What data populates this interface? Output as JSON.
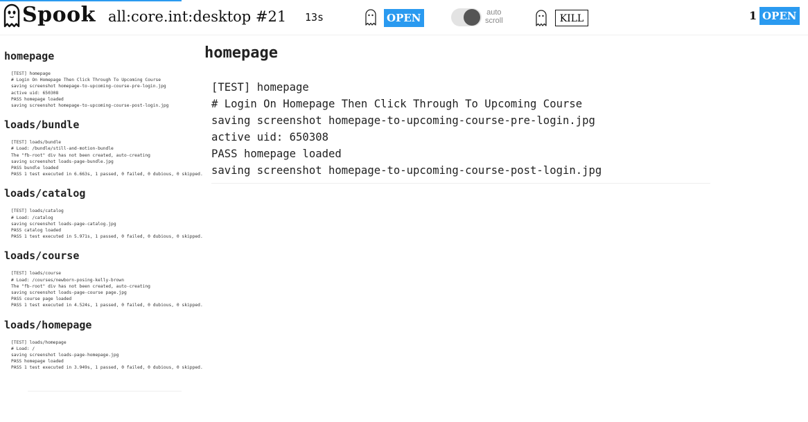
{
  "app": {
    "name": "Spook"
  },
  "header": {
    "job_name": "all:core.int:desktop #21",
    "elapsed": "13s",
    "open_label": "OPEN",
    "autoscroll_line1": "auto",
    "autoscroll_line2": "scroll",
    "autoscroll_enabled": true,
    "kill_label": "KILL",
    "count": "1",
    "open_label_right": "OPEN",
    "accent_color": "#2a9af0"
  },
  "icons": {
    "logo": "ghost-icon",
    "runner": "ghost-icon"
  },
  "tests": [
    {
      "name": "homepage",
      "log": "[TEST] homepage\n# Login On Homepage Then Click Through To Upcoming Course\nsaving screenshot homepage-to-upcoming-course-pre-login.jpg\nactive uid: 650308\nPASS homepage loaded\nsaving screenshot homepage-to-upcoming-course-post-login.jpg"
    },
    {
      "name": "loads/bundle",
      "log": "[TEST] loads/bundle\n# Load: /bundle/still-and-motion-bundle\nThe \"fb-root\" div has not been created, auto-creating\nsaving screenshot loads-page-bundle.jpg\nPASS bundle loaded\nPASS 1 test executed in 6.663s, 1 passed, 0 failed, 0 dubious, 0 skipped."
    },
    {
      "name": "loads/catalog",
      "log": "[TEST] loads/catalog\n# Load: /catalog\nsaving screenshot loads-page-catalog.jpg\nPASS catalog loaded\nPASS 1 test executed in 5.971s, 1 passed, 0 failed, 0 dubious, 0 skipped."
    },
    {
      "name": "loads/course",
      "log": "[TEST] loads/course\n# Load: /courses/newborn-posing-kelly-brown\nThe \"fb-root\" div has not been created, auto-creating\nsaving screenshot loads-page-course page.jpg\nPASS course page loaded\nPASS 1 test executed in 4.524s, 1 passed, 0 failed, 0 dubious, 0 skipped."
    },
    {
      "name": "loads/homepage",
      "log": "[TEST] loads/homepage\n# Load: /\nsaving screenshot loads-page-homepage.jpg\nPASS homepage loaded\nPASS 1 test executed in 3.949s, 1 passed, 0 failed, 0 dubious, 0 skipped."
    }
  ],
  "main": {
    "title": "homepage",
    "log": "[TEST] homepage\n# Login On Homepage Then Click Through To Upcoming Course\nsaving screenshot homepage-to-upcoming-course-pre-login.jpg\nactive uid: 650308\nPASS homepage loaded\nsaving screenshot homepage-to-upcoming-course-post-login.jpg"
  }
}
